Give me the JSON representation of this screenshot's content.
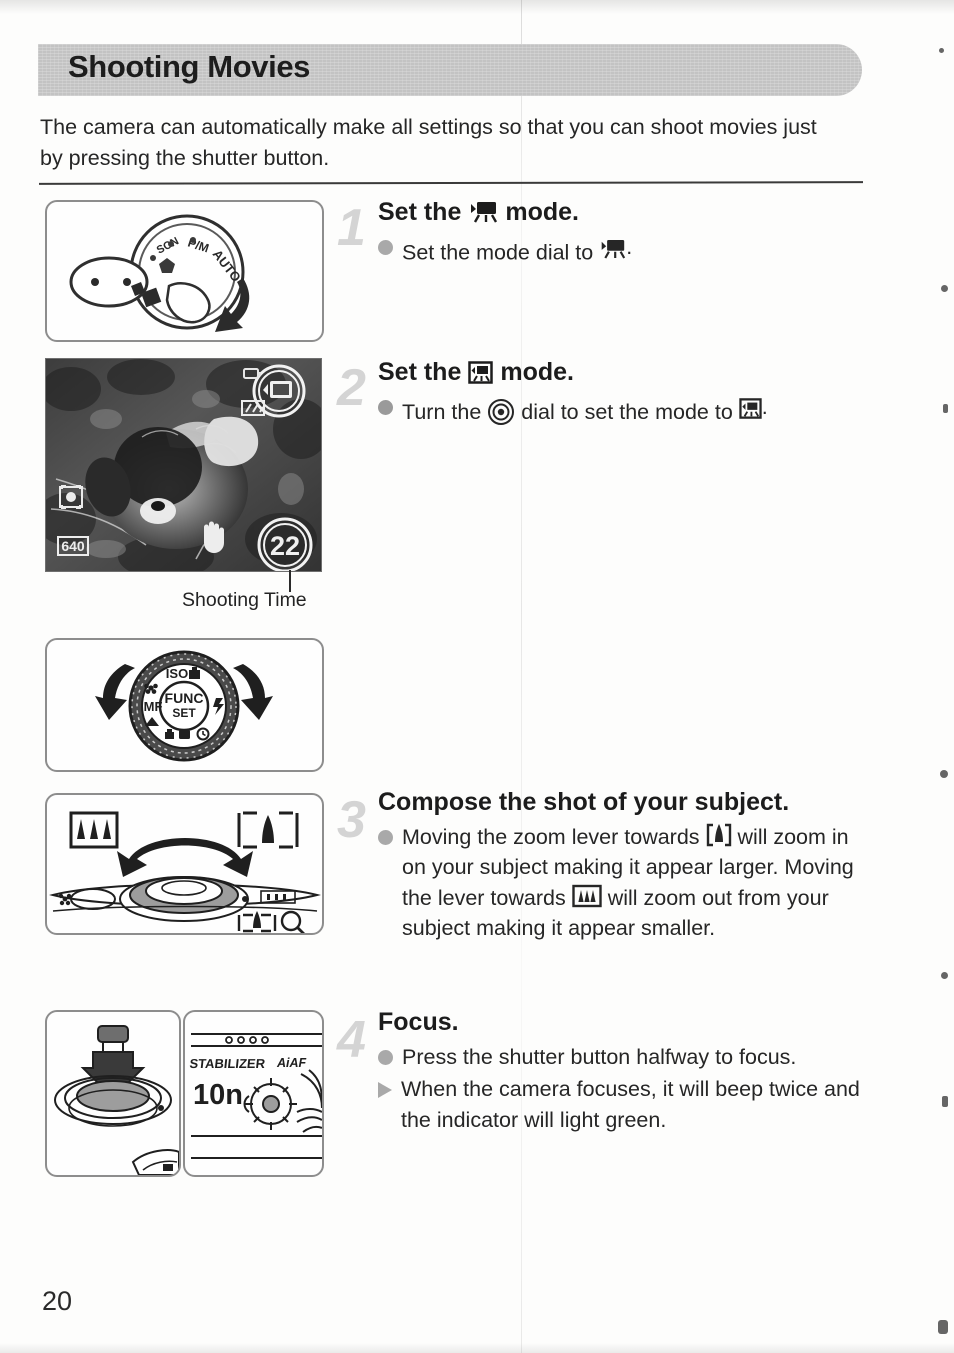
{
  "page": {
    "title": "Shooting Movies",
    "number": "20",
    "intro": "The camera can automatically make all settings so that you can shoot movies just by pressing the shutter button."
  },
  "steps": [
    {
      "number": "1",
      "heading_before": "Set the",
      "heading_icon": "movie-mode-icon",
      "heading_after": "mode.",
      "bullets": [
        {
          "marker": "dot",
          "text_before": "Set the mode dial to",
          "icon": "movie-mode-icon",
          "text_after": "."
        }
      ],
      "figure": {
        "name": "mode-dial-figure",
        "labels": [
          "AUTO",
          "P/M",
          "SCN"
        ]
      }
    },
    {
      "number": "2",
      "heading_before": "Set the",
      "heading_icon": "movie-mode-boxed-icon",
      "heading_after": "mode.",
      "bullets": [
        {
          "marker": "dot",
          "text_before": "Turn the",
          "icon": "control-dial-icon",
          "text_mid": "dial to set the mode to",
          "icon2": "movie-mode-boxed-icon",
          "text_after": "."
        }
      ],
      "figure": {
        "name": "lcd-preview-figure",
        "caption": "Shooting Time",
        "osd": {
          "mode": "movie-mode-boxed-icon",
          "battery": "battery-icon",
          "metering": "metering-icon",
          "resolution": "640",
          "stabilizer": "hand-icon",
          "shooting_time": "22"
        }
      },
      "figure2": {
        "name": "control-dial-figure",
        "labels": [
          "ISO",
          "MF",
          "FUNC",
          "SET"
        ]
      }
    },
    {
      "number": "3",
      "heading_before": "Compose the shot of your subject.",
      "bullets": [
        {
          "marker": "dot",
          "text_before": "Moving the zoom lever towards",
          "icon": "telephoto-icon",
          "text_mid": "will zoom in on your subject making it appear larger. Moving the lever towards",
          "icon2": "wide-angle-icon",
          "text_after": "will zoom out from your subject making it appear smaller."
        }
      ],
      "figure": {
        "name": "zoom-lever-figure"
      }
    },
    {
      "number": "4",
      "heading_before": "Focus.",
      "bullets": [
        {
          "marker": "dot",
          "text_before": "Press the shutter button halfway to focus."
        },
        {
          "marker": "triangle",
          "text_before": "When the camera focuses, it will beep twice and the indicator will light green."
        }
      ],
      "figure": {
        "name": "shutter-press-figure"
      },
      "figure2": {
        "name": "camera-front-figure",
        "labels": [
          "STABILIZER",
          "AiAF",
          "10n"
        ]
      }
    }
  ],
  "colors": {
    "header_bar": "#c3c3c3",
    "text": "#262626",
    "step_number": "#d4d4d4",
    "bullet": "#a9a9a9",
    "figure_border": "#8d8d8d"
  }
}
